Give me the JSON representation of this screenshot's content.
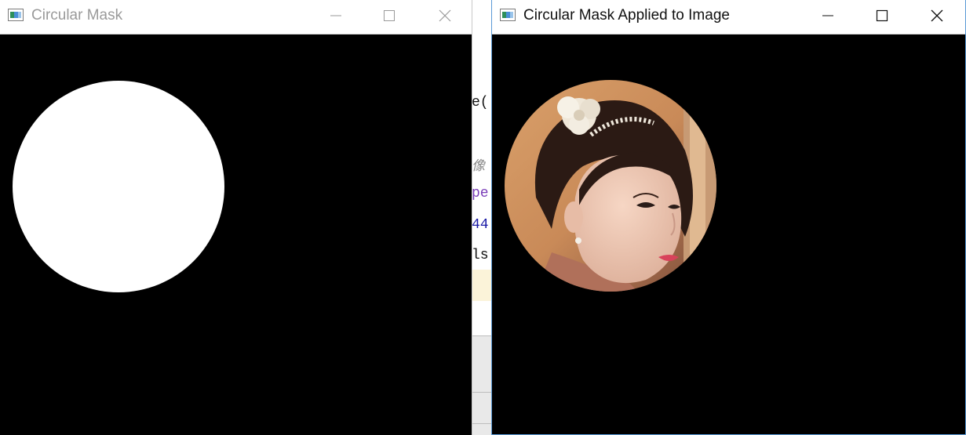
{
  "background_editor": {
    "lines": [
      "e(",
      "像",
      "pe",
      "44",
      "ls"
    ]
  },
  "window_mask": {
    "title": "Circular Mask",
    "controls": {
      "minimize": "minimize-icon",
      "maximize": "maximize-icon",
      "close": "close-icon"
    }
  },
  "window_applied": {
    "title": "Circular Mask Applied to Image",
    "controls": {
      "minimize": "minimize-icon",
      "maximize": "maximize-icon",
      "close": "close-icon"
    }
  },
  "colors": {
    "title_active": "#111111",
    "title_inactive": "#9a9a9a",
    "mask_fg": "#ffffff",
    "canvas_bg": "#000000",
    "code_purple": "#7a3db8",
    "code_blue": "#1a1aa6"
  }
}
